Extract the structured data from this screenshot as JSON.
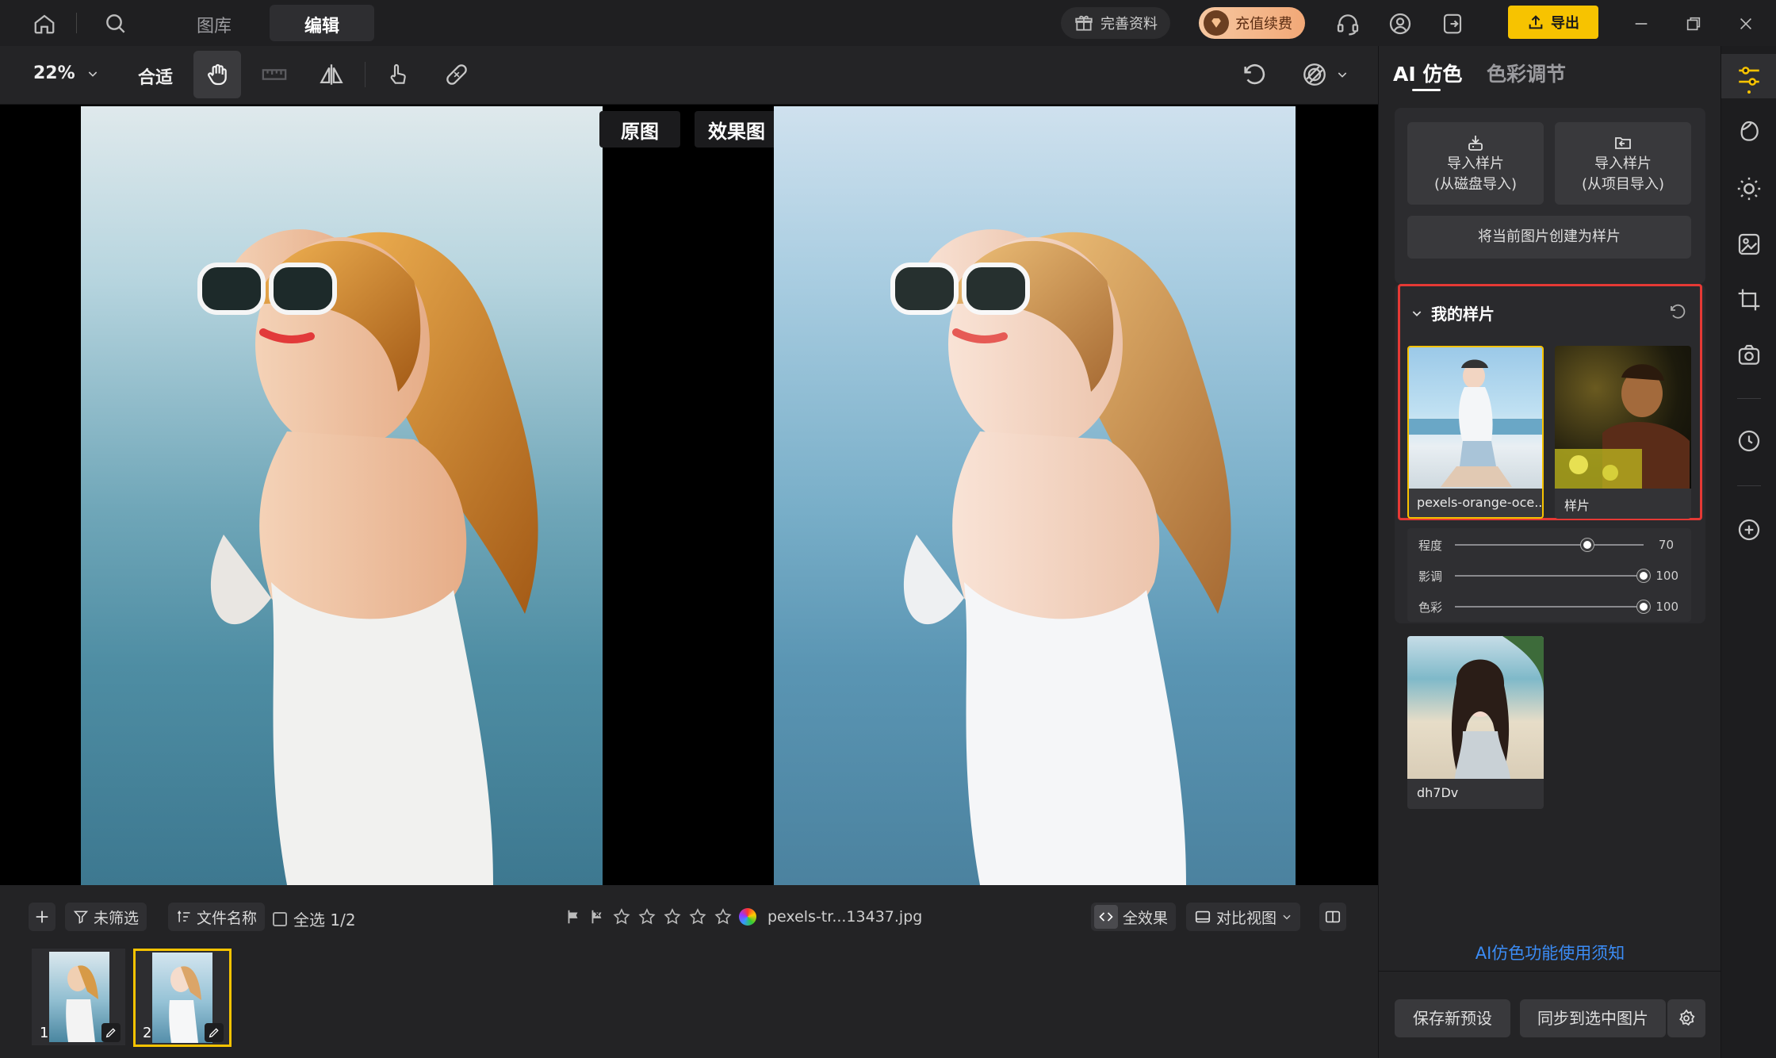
{
  "topbar": {
    "tabs": [
      {
        "label": "图库"
      },
      {
        "label": "编辑"
      }
    ],
    "complete_profile": "完善资料",
    "recharge": "充值续费",
    "export": "导出"
  },
  "toolbar": {
    "zoom": "22%",
    "fit": "合适"
  },
  "canvas": {
    "original_label": "原图",
    "effect_label": "效果图"
  },
  "strip": {
    "filter": "未筛选",
    "sort": "文件名称",
    "select_all": "全选 1/2",
    "filename": "pexels-tr...13437.jpg",
    "full_effect": "全效果",
    "compare_view": "对比视图",
    "thumbs": [
      {
        "index": "1"
      },
      {
        "index": "2"
      }
    ]
  },
  "panel": {
    "tabs": [
      {
        "label": "AI 仿色"
      },
      {
        "label": "色彩调节"
      }
    ],
    "import_disk": [
      "导入样片",
      "(从磁盘导入)"
    ],
    "import_project": [
      "导入样片",
      "(从项目导入)"
    ],
    "create_sample": "将当前图片创建为样片",
    "my_samples_title": "我的样片",
    "samples": [
      {
        "name": "pexels-orange-oce..."
      },
      {
        "name": "样片"
      },
      {
        "name": "dh7Dv"
      }
    ],
    "sliders": [
      {
        "label": "程度",
        "value": "70",
        "fraction": 0.7
      },
      {
        "label": "影调",
        "value": "100",
        "fraction": 1.0
      },
      {
        "label": "色彩",
        "value": "100",
        "fraction": 1.0
      }
    ],
    "help_link": "AI仿色功能使用须知",
    "save_preset": "保存新预设",
    "sync": "同步到选中图片"
  },
  "colors": {
    "accent_yellow": "#f7c300",
    "highlight_red": "#e53935",
    "link_blue": "#3b8cf5"
  }
}
